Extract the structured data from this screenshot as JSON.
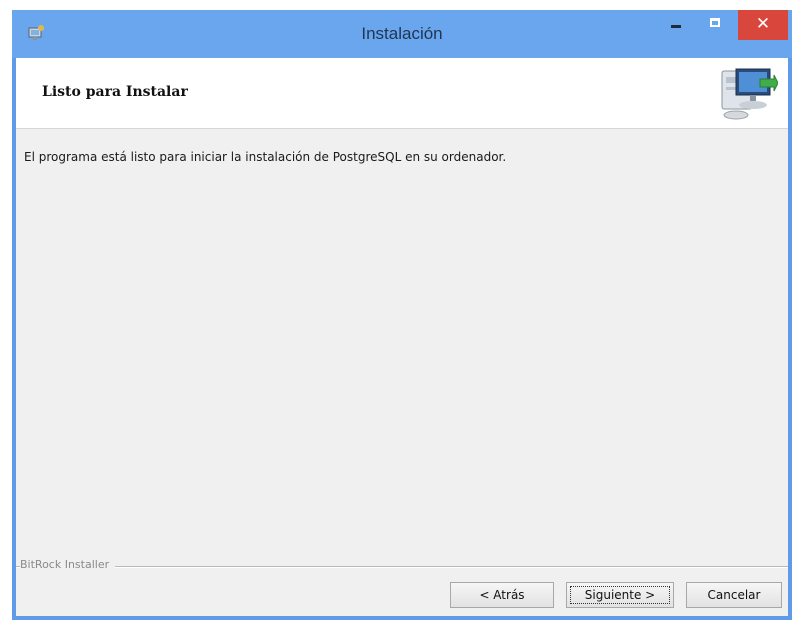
{
  "window": {
    "title": "Instalación",
    "close_glyph": "✕",
    "icons": {
      "app": "installer-icon",
      "minimize": "minimize-icon",
      "maximize": "maximize-icon",
      "close": "close-icon"
    }
  },
  "header": {
    "title": "Listo para Instalar",
    "icon": "computer-install-icon"
  },
  "body": {
    "message": "El programa está listo para iniciar la instalación de PostgreSQL en su ordenador."
  },
  "footer": {
    "brand": "BitRock Installer",
    "back_label": "< Atrás",
    "next_label": "Siguiente >",
    "cancel_label": "Cancelar"
  },
  "colors": {
    "title_bar": "#6aa6ee",
    "close_button": "#d9463c",
    "client_background": "#f0f0f0"
  }
}
